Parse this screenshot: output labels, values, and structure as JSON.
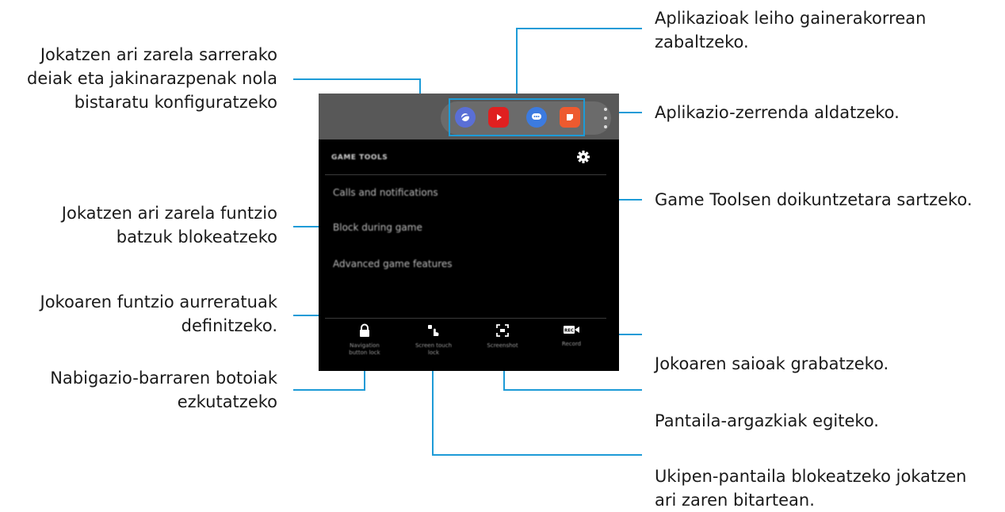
{
  "callouts": {
    "popup_apps": [
      "Aplikazioak leiho gainerakorrean",
      "zabaltzeko."
    ],
    "change_app_list": [
      "Aplikazio-zerrenda aldatzeko."
    ],
    "settings": [
      "Game Toolsen doikuntzetara sartzeko."
    ],
    "calls_notifications": [
      "Jokatzen ari zarela sarrerako",
      "deiak eta jakinarazpenak nola",
      "bistaratu konfiguratzeko"
    ],
    "block_features": [
      "Jokatzen ari zarela funtzio",
      "batzuk blokeatzeko"
    ],
    "advanced_features": [
      "Jokoaren funtzio aurreratuak",
      "definitzeko."
    ],
    "nav_buttons": [
      "Nabigazio-barraren botoiak",
      "ezkutatzeko"
    ],
    "record": [
      "Jokoaren saioak grabatzeko."
    ],
    "screenshot": [
      "Pantaila-argazkiak egiteko."
    ],
    "screen_touch_lock": [
      "Ukipen-pantaila blokeatzeko jokatzen",
      "ari zaren bitartean."
    ]
  },
  "phone": {
    "header": "GAME TOOLS",
    "menu": [
      "Calls and notifications",
      "Block during game",
      "Advanced game features"
    ],
    "tools": [
      {
        "icon": "lock-icon",
        "label": [
          "Navigation",
          "button lock"
        ]
      },
      {
        "icon": "touch-lock-icon",
        "label": [
          "Screen touch",
          "lock"
        ]
      },
      {
        "icon": "screenshot-icon",
        "label": [
          "Screenshot"
        ]
      },
      {
        "icon": "rec-icon",
        "label": [
          "Record"
        ]
      }
    ],
    "apps": [
      "browser-app-icon",
      "youtube-app-icon",
      "messages-app-icon",
      "notes-app-icon"
    ]
  },
  "colors": {
    "leader": "#1d9bd7",
    "phone_bg": "#000000",
    "topbar": "#585858",
    "youtube": "#e02020",
    "messages": "#3c7be0",
    "browser": "#5a6fd6",
    "notes": "#ee5a2f"
  }
}
